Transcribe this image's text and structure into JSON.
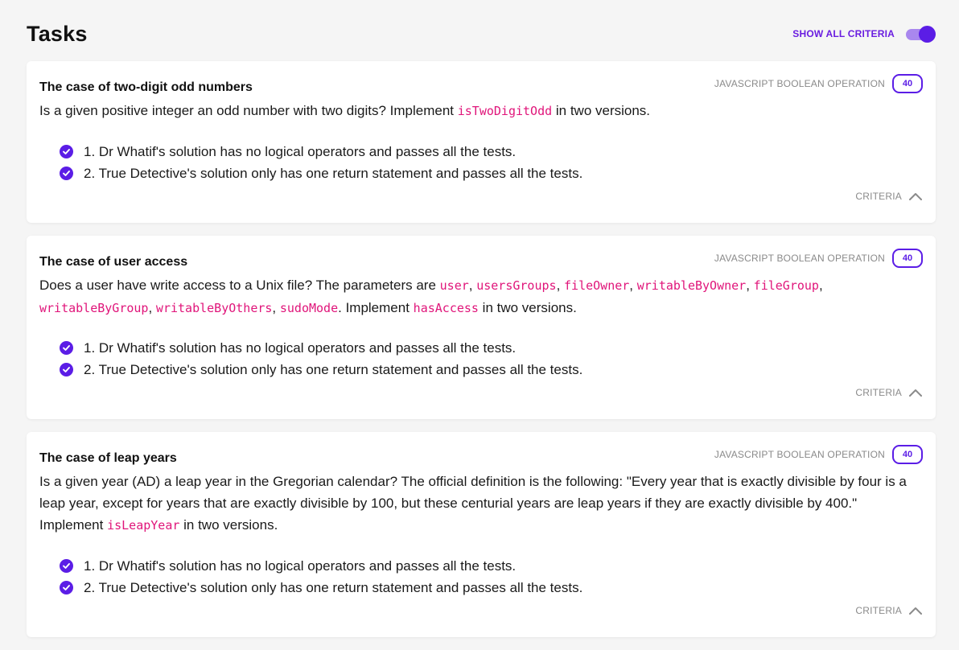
{
  "page": {
    "title": "Tasks"
  },
  "toggle": {
    "label": "SHOW ALL CRITERIA",
    "on": true
  },
  "colors": {
    "accent": "#5b1de6",
    "code": "#e0157a",
    "muted": "#8a8a8a"
  },
  "tasks": [
    {
      "title": "The case of two-digit odd numbers",
      "category": "JAVASCRIPT BOOLEAN OPERATION",
      "points": "40",
      "desc": [
        {
          "t": "text",
          "v": "Is a given positive integer an odd number with two digits? Implement "
        },
        {
          "t": "code",
          "v": "isTwoDigitOdd"
        },
        {
          "t": "text",
          "v": " in two versions."
        }
      ],
      "criteria": [
        "1. Dr Whatif's solution has no logical operators and passes all the tests.",
        "2. True Detective's solution only has one return statement and passes all the tests."
      ],
      "criteria_label": "CRITERIA"
    },
    {
      "title": "The case of user access",
      "category": "JAVASCRIPT BOOLEAN OPERATION",
      "points": "40",
      "desc": [
        {
          "t": "text",
          "v": "Does a user have write access to a Unix file? The parameters are "
        },
        {
          "t": "code",
          "v": "user"
        },
        {
          "t": "text",
          "v": ", "
        },
        {
          "t": "code",
          "v": "usersGroups"
        },
        {
          "t": "text",
          "v": ", "
        },
        {
          "t": "code",
          "v": "fileOwner"
        },
        {
          "t": "text",
          "v": ", "
        },
        {
          "t": "code",
          "v": "writableByOwner"
        },
        {
          "t": "text",
          "v": ", "
        },
        {
          "t": "code",
          "v": "fileGroup"
        },
        {
          "t": "text",
          "v": ", "
        },
        {
          "t": "code",
          "v": "writableByGroup"
        },
        {
          "t": "text",
          "v": ", "
        },
        {
          "t": "code",
          "v": "writableByOthers"
        },
        {
          "t": "text",
          "v": ", "
        },
        {
          "t": "code",
          "v": "sudoMode"
        },
        {
          "t": "text",
          "v": ". Implement "
        },
        {
          "t": "code",
          "v": "hasAccess"
        },
        {
          "t": "text",
          "v": " in two versions."
        }
      ],
      "criteria": [
        "1. Dr Whatif's solution has no logical operators and passes all the tests.",
        "2. True Detective's solution only has one return statement and passes all the tests."
      ],
      "criteria_label": "CRITERIA"
    },
    {
      "title": "The case of leap years",
      "category": "JAVASCRIPT BOOLEAN OPERATION",
      "points": "40",
      "desc": [
        {
          "t": "text",
          "v": "Is a given year (AD) a leap year in the Gregorian calendar? The official definition is the following: \"Every year that is exactly divisible by four is a leap year, except for years that are exactly divisible by 100, but these centurial years are leap years if they are exactly divisible by 400.\" Implement "
        },
        {
          "t": "code",
          "v": "isLeapYear"
        },
        {
          "t": "text",
          "v": " in two versions."
        }
      ],
      "criteria": [
        "1. Dr Whatif's solution has no logical operators and passes all the tests.",
        "2. True Detective's solution only has one return statement and passes all the tests."
      ],
      "criteria_label": "CRITERIA"
    }
  ]
}
